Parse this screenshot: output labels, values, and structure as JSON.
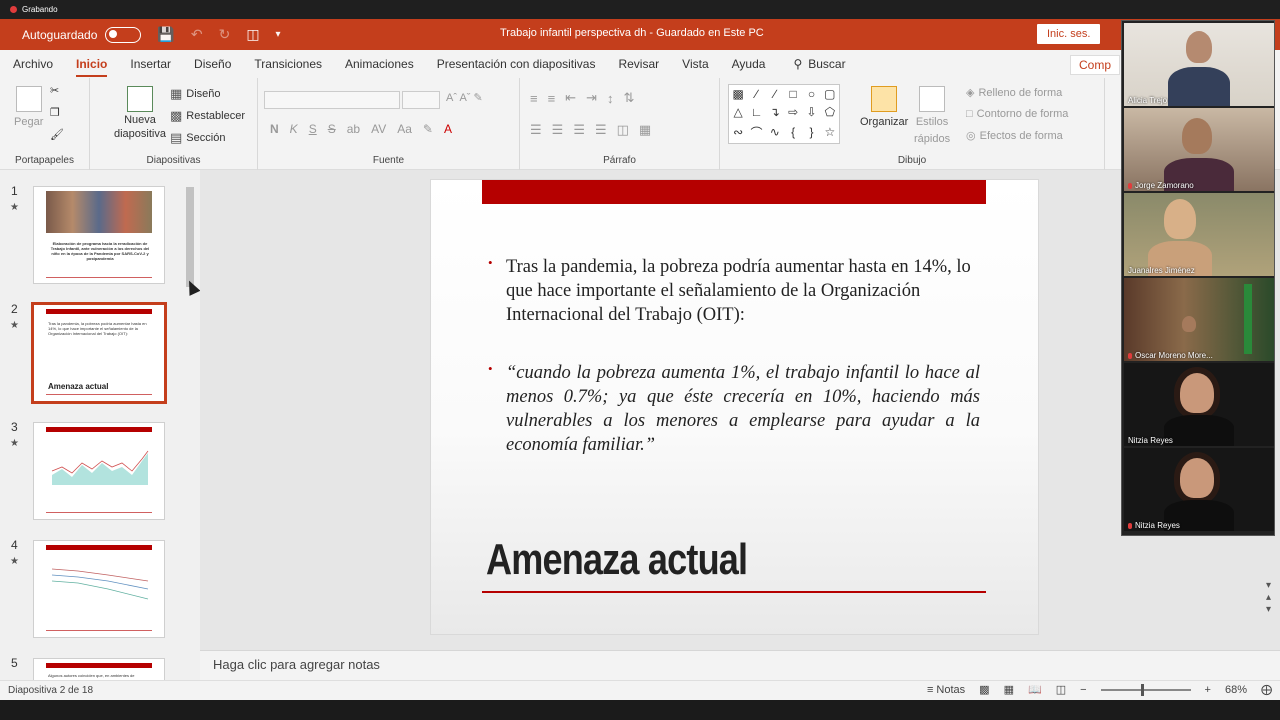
{
  "recording": {
    "label": "Grabando"
  },
  "titlebar": {
    "autosave_label": "Autoguardado",
    "doc_title": "Trabajo infantil perspectiva dh  -  Guardado en Este PC",
    "signin_label": "Inic. ses."
  },
  "tabs": [
    "Archivo",
    "Inicio",
    "Insertar",
    "Diseño",
    "Transiciones",
    "Animaciones",
    "Presentación con diapositivas",
    "Revisar",
    "Vista",
    "Ayuda"
  ],
  "search_label": "Buscar",
  "share_label": "Comp",
  "ribbon": {
    "portapapeles": {
      "label": "Portapapeles",
      "paste": "Pegar"
    },
    "diapositivas": {
      "label": "Diapositivas",
      "new": "Nueva",
      "new2": "diapositiva",
      "layout": "Diseño",
      "reset": "Restablecer",
      "section": "Sección"
    },
    "fuente": {
      "label": "Fuente",
      "bold": "N",
      "italic": "K",
      "underline": "S",
      "strike": "S",
      "shadow": "ab",
      "spacing": "AV",
      "case": "Aa"
    },
    "parrafo": {
      "label": "Párrafo"
    },
    "dibujo": {
      "label": "Dibujo",
      "arrange": "Organizar",
      "styles1": "Estilos",
      "styles2": "rápidos",
      "fill": "Relleno de forma",
      "outline": "Contorno de forma",
      "effects": "Efectos de forma"
    }
  },
  "thumbnails": [
    {
      "num": "1",
      "text": "Elaboración de programa hacia la erradicación de Trabajo Infantil, ante vulneración a los derechos del niño en la época de la Pandemia por SARS-CoV-2 y postpandemia"
    },
    {
      "num": "2",
      "title": "Amenaza actual",
      "text": "Tras la pandemia, la pobreza podría aumentar hasta en 14%, lo que hace importante el señalamiento de la Organización Internacional del Trabajo (OIT):"
    },
    {
      "num": "3"
    },
    {
      "num": "4"
    },
    {
      "num": "5",
      "text": "Algunos autores coinciden que, en ambientes de"
    }
  ],
  "slide": {
    "bullet1": "Tras la pandemia, la pobreza podría aumentar hasta en 14%, lo que hace importante el señalamiento de la Organización Internacional del Trabajo (OIT):",
    "bullet2": "“cuando la pobreza aumenta 1%, el trabajo infantil lo hace al menos 0.7%; ya que éste crecería en 10%, haciendo más vulnerables a los menores a emplearse para ayudar a la economía familiar.”",
    "title": "Amenaza actual"
  },
  "notes_placeholder": "Haga clic para agregar notas",
  "status": {
    "slide_info": "Diapositiva 2 de 18",
    "notes_label": "Notas",
    "zoom": "68%"
  },
  "participants": [
    {
      "name": "Alicia Trejo",
      "muted": false
    },
    {
      "name": "Jorge Zamorano",
      "muted": true
    },
    {
      "name": "Juanalres Jiménez",
      "muted": false
    },
    {
      "name": "Oscar Moreno More...",
      "muted": true
    },
    {
      "name": "Nitzia Reyes",
      "muted": false
    },
    {
      "name": "Nitzia Reyes",
      "muted": true
    }
  ],
  "colors": {
    "accent": "#c43e1c",
    "slide_red": "#b50000"
  }
}
